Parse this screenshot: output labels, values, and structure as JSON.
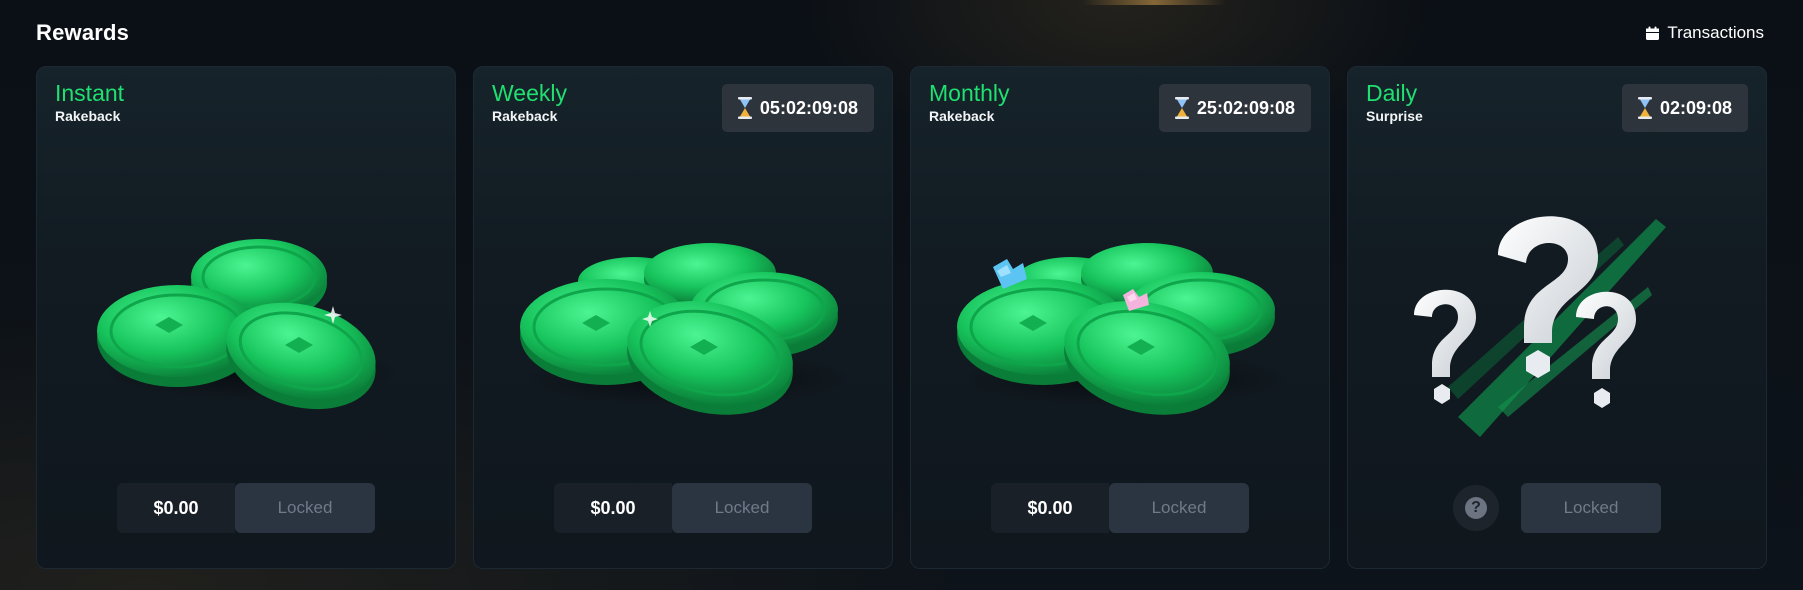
{
  "header": {
    "title": "Rewards",
    "transactions_label": "Transactions"
  },
  "cards": [
    {
      "name": "Instant",
      "subtitle": "Rakeback",
      "amount": "$0.00",
      "button": "Locked"
    },
    {
      "name": "Weekly",
      "subtitle": "Rakeback",
      "timer": "05:02:09:08",
      "amount": "$0.00",
      "button": "Locked"
    },
    {
      "name": "Monthly",
      "subtitle": "Rakeback",
      "timer": "25:02:09:08",
      "amount": "$0.00",
      "button": "Locked"
    },
    {
      "name": "Daily",
      "subtitle": "Surprise",
      "timer": "02:09:08",
      "help_icon": "?",
      "button": "Locked"
    }
  ],
  "colors": {
    "accent_green": "#1fe070",
    "card_bg": "#121b22",
    "locked_bg": "#2b3441",
    "locked_text": "#6f7b89",
    "timer_bg": "#2e343b"
  },
  "icons": [
    "calendar-icon",
    "hourglass-icon",
    "question-icon"
  ]
}
